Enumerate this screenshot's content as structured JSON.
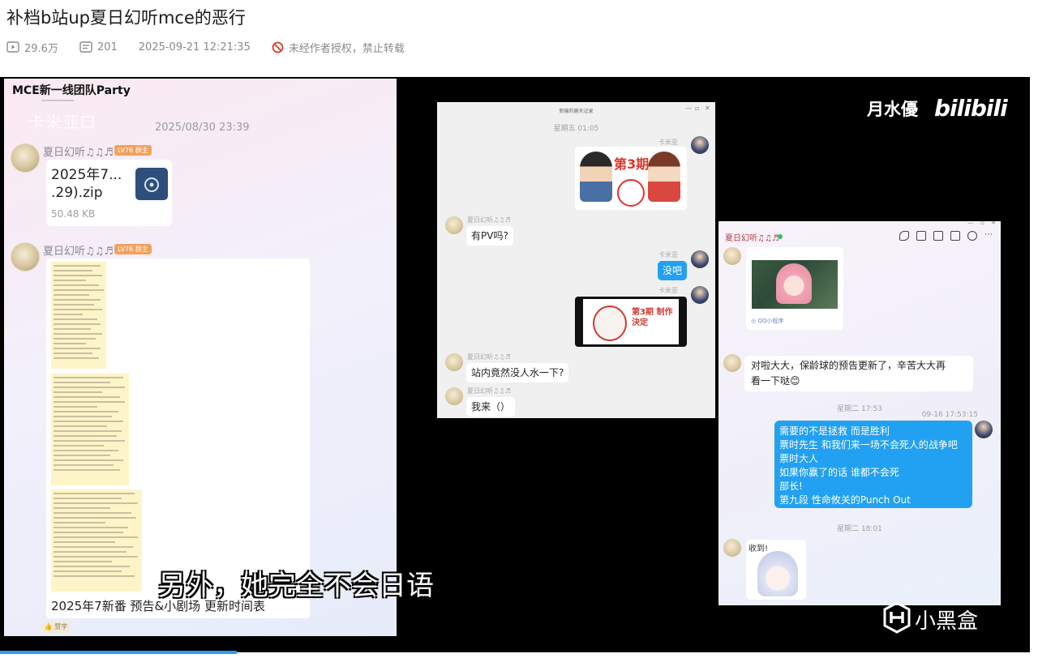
{
  "post": {
    "title": "补档b站up夏日幻听mce的恶行",
    "views": "29.6万",
    "comments": "201",
    "datetime": "2025-09-21 12:21:35",
    "copyright_notice": "未经作者授权，禁止转载"
  },
  "left_panel": {
    "group_name": "MCE新一线团队Party",
    "ghost_text": "卡米亚口",
    "timestamp": "2025/08/30 23:39",
    "sender": "夏日幻听♫♫♬",
    "badge": "LV76 群主",
    "file": {
      "name": "2025年7...",
      "name2": ".29).zip",
      "size": "50.48 KB"
    },
    "image_caption": "2025年7新番 预告&小剧场 更新时间表",
    "reaction": "👍 赞字"
  },
  "middle_chat": {
    "window_title": "新输的聊天记录",
    "time_header": "星期五 01:05",
    "other_name": "卡米亚",
    "self_name": "夏日幻听♫♫♬",
    "sticker1_text": "第3期",
    "msg1": "有PV吗?",
    "reply1": "没吧",
    "sticker2_text": "第3期 制作決定",
    "msg2": "站内竟然没人水一下?",
    "msg3": "我来（）"
  },
  "right_chat": {
    "contact_name": "夏日幻听♫♫♬",
    "card_footer": "QQ小程序",
    "message1_lines": [
      "对啦大大，保龄球的预告更新了，辛苦大大再",
      "看一下哒😊"
    ],
    "date1": "星期二 17:53",
    "stamp": "09-16 17:53:15",
    "reply_lines": [
      "需要的不是拯救 而是胜利",
      "票时先生 和我们来一场不会死人的战争吧",
      "票时大人",
      "如果你赢了的话 谁都不会死",
      "部长!",
      "第九段 性命攸关的Punch Out"
    ],
    "date2": "星期二 18:01",
    "sticker_label": "收到!"
  },
  "overlay": {
    "watermark_name": "月水優",
    "watermark_brand": "bilibili",
    "subtitle": "另外，她完全不会日语",
    "corner_logo": "小黑盒"
  }
}
